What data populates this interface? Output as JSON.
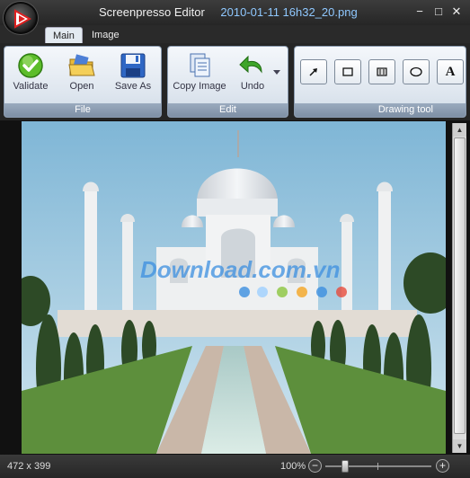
{
  "window": {
    "app_title": "Screenpresso Editor",
    "file_name": "2010-01-11 16h32_20.png",
    "minimize_glyph": "−",
    "maximize_glyph": "□",
    "close_glyph": "✕"
  },
  "tabs": [
    {
      "label": "Main",
      "selected": true
    },
    {
      "label": "Image",
      "selected": false
    }
  ],
  "ribbon": {
    "file_group": {
      "label": "File",
      "buttons": [
        {
          "label": "Validate",
          "icon": "checkmark-icon"
        },
        {
          "label": "Open",
          "icon": "folder-icon"
        },
        {
          "label": "Save As",
          "icon": "floppy-disk-icon"
        }
      ]
    },
    "edit_group": {
      "label": "Edit",
      "buttons": [
        {
          "label": "Copy Image",
          "icon": "copy-icon"
        },
        {
          "label": "Undo",
          "icon": "undo-arrow-icon"
        }
      ]
    },
    "drawing_group": {
      "label": "Drawing tool",
      "tools": [
        {
          "icon": "arrow-icon"
        },
        {
          "icon": "rectangle-icon"
        },
        {
          "icon": "highlight-icon"
        },
        {
          "icon": "ellipse-icon"
        },
        {
          "icon": "text-icon",
          "glyph": "A"
        }
      ]
    }
  },
  "canvas": {
    "image_description_visible": false,
    "watermark_text": "Download.com.vn"
  },
  "status": {
    "dimensions": "472 x 399",
    "zoom": "100%",
    "zoom_out": "−",
    "zoom_in": "+"
  },
  "colors": {
    "accent_blue": "#8fc8ff",
    "ribbon_label": "#7e8fa5",
    "validate_green": "#4caf1f"
  }
}
